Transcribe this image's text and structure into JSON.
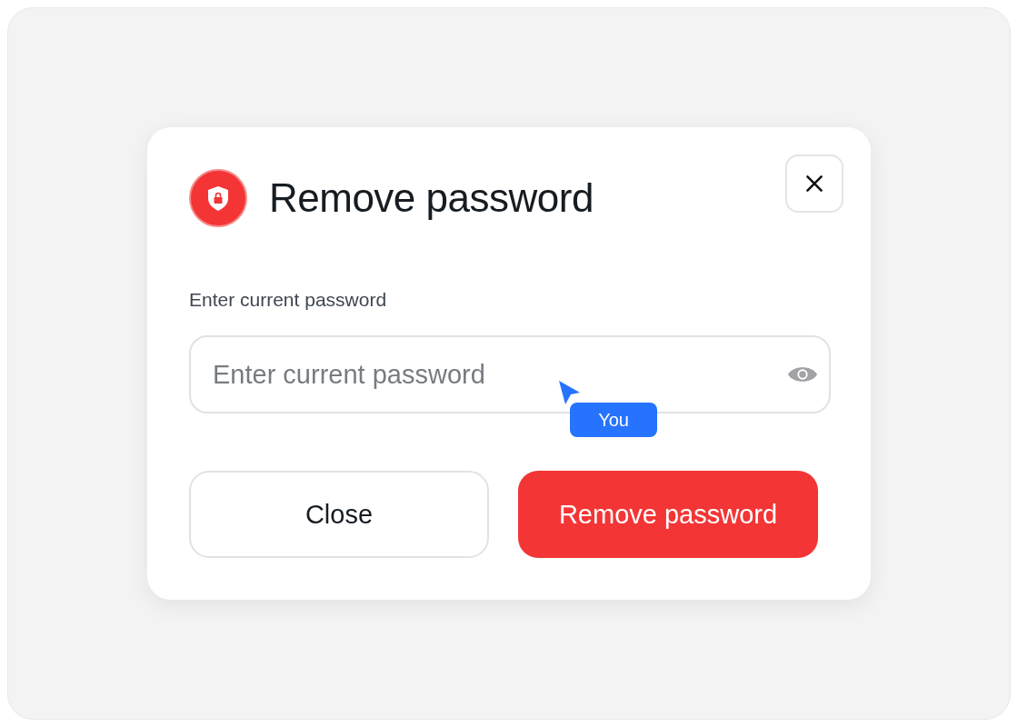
{
  "dialog": {
    "title": "Remove password",
    "field": {
      "label": "Enter current password",
      "placeholder": "Enter current password"
    },
    "buttons": [
      {
        "label": "Close",
        "kind": "secondary"
      },
      {
        "label": "Remove password",
        "kind": "danger"
      }
    ]
  },
  "cursor": {
    "label": "You"
  }
}
